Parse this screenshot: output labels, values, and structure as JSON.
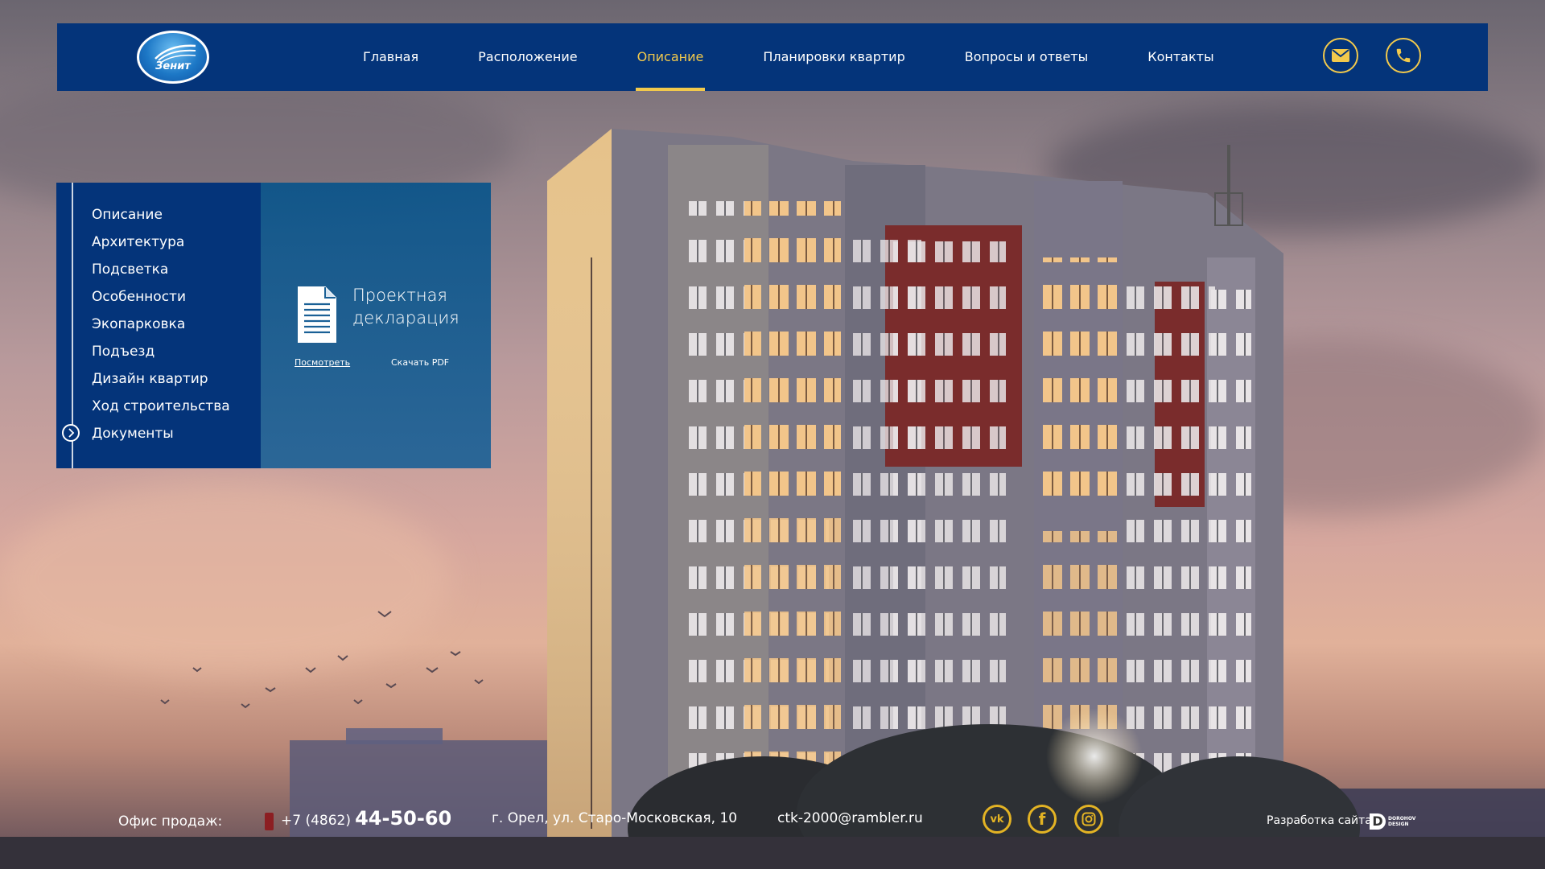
{
  "header": {
    "logo_text": "Зенит",
    "nav": [
      {
        "label": "Главная",
        "active": false
      },
      {
        "label": "Расположение",
        "active": false
      },
      {
        "label": "Описание",
        "active": true
      },
      {
        "label": "Планировки квартир",
        "active": false
      },
      {
        "label": "Вопросы и ответы",
        "active": false
      },
      {
        "label": "Контакты",
        "active": false
      }
    ],
    "icons": [
      "mail-icon",
      "phone-icon"
    ]
  },
  "sidebar": {
    "items": [
      {
        "label": "Описание"
      },
      {
        "label": "Архитектура"
      },
      {
        "label": "Подсветка"
      },
      {
        "label": "Особенности"
      },
      {
        "label": "Экопарковка"
      },
      {
        "label": "Подъезд"
      },
      {
        "label": "Дизайн квартир"
      },
      {
        "label": "Ход строительства"
      },
      {
        "label": "Документы",
        "current": true
      }
    ]
  },
  "document": {
    "title_line1": "Проектная",
    "title_line2": "декларация",
    "view_label": "Посмотреть",
    "download_label": "Скачать PDF"
  },
  "footer": {
    "office_label": "Офис продаж:",
    "phone_prefix": "+7 (4862)",
    "phone_number": "44-50-60",
    "address": "г. Орел, ул. Старо-Московская, 10",
    "email": "ctk-2000@rambler.ru",
    "socials": [
      "vk-icon",
      "facebook-icon",
      "instagram-icon"
    ],
    "developer_label": "Разработка сайта -",
    "developer_logo_line1": "DOROHOV",
    "developer_logo_line2": "DESIGN"
  },
  "colors": {
    "header_bg": "#04347a",
    "accent": "#f2c94c",
    "social": "#e3b324",
    "doc_panel": "#1a6096"
  }
}
